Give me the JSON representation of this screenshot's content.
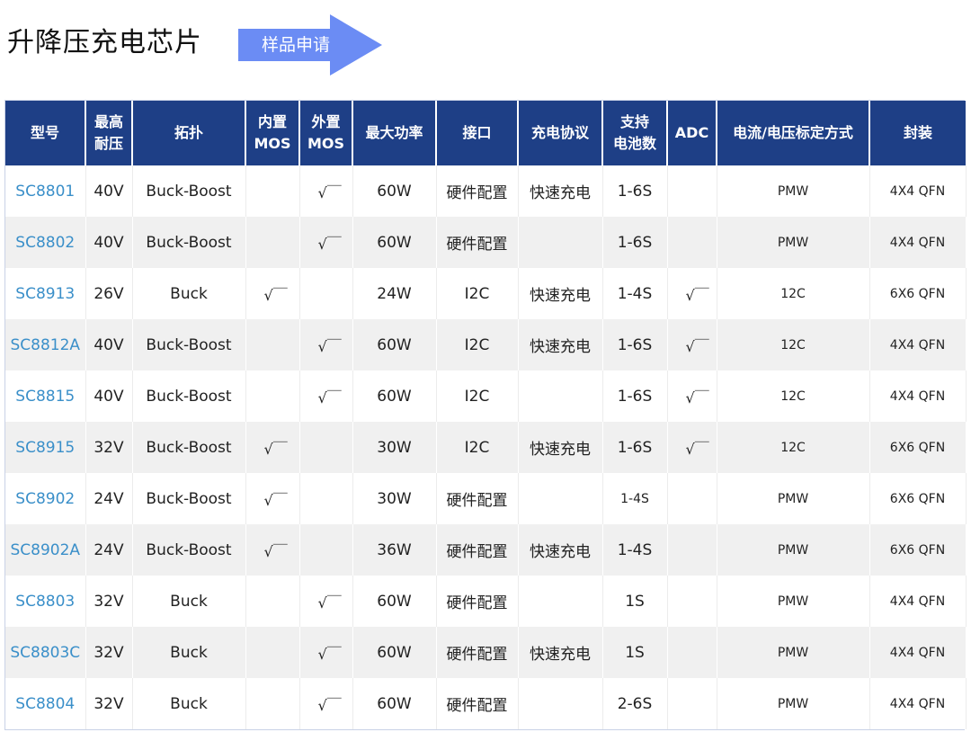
{
  "header": {
    "title": "升降压充电芯片",
    "sample_button_label": "样品申请",
    "button_color": "#6b8cf4"
  },
  "table": {
    "header_color": "#1e3f86",
    "model_color": "#3a8fc9",
    "columns": [
      {
        "key": "model",
        "line1": "型号",
        "line2": ""
      },
      {
        "key": "vmax",
        "line1": "最高",
        "line2": "耐压"
      },
      {
        "key": "topology",
        "line1": "拓扑",
        "line2": ""
      },
      {
        "key": "int_mos",
        "line1": "内置",
        "line2": "MOS"
      },
      {
        "key": "ext_mos",
        "line1": "外置",
        "line2": "MOS"
      },
      {
        "key": "pmax",
        "line1": "最大功率",
        "line2": ""
      },
      {
        "key": "interface",
        "line1": "接口",
        "line2": ""
      },
      {
        "key": "protocol",
        "line1": "充电协议",
        "line2": ""
      },
      {
        "key": "cells",
        "line1": "支持",
        "line2": "电池数"
      },
      {
        "key": "adc",
        "line1": "ADC",
        "line2": ""
      },
      {
        "key": "calib",
        "line1": "电流/电压标定方式",
        "line2": ""
      },
      {
        "key": "package",
        "line1": "封装",
        "line2": ""
      }
    ],
    "rows": [
      {
        "model": "SC8801",
        "vmax": "40V",
        "topology": "Buck-Boost",
        "int_mos": "",
        "ext_mos": "√￣",
        "pmax": "60W",
        "interface": "硬件配置",
        "protocol": "快速充电",
        "cells": "1-6S",
        "adc": "",
        "calib": "PMW",
        "package": "4X4  QFN"
      },
      {
        "model": "SC8802",
        "vmax": "40V",
        "topology": "Buck-Boost",
        "int_mos": "",
        "ext_mos": "√￣",
        "pmax": "60W",
        "interface": "硬件配置",
        "protocol": "",
        "cells": "1-6S",
        "adc": "",
        "calib": "PMW",
        "package": "4X4 QFN"
      },
      {
        "model": "SC8913",
        "vmax": "26V",
        "topology": "Buck",
        "int_mos": "√￣",
        "ext_mos": "",
        "pmax": "24W",
        "interface": "I2C",
        "protocol": "快速充电",
        "cells": "1-4S",
        "adc": "√￣",
        "calib": "12C",
        "package": "6X6 QFN"
      },
      {
        "model": "SC8812A",
        "vmax": "40V",
        "topology": "Buck-Boost",
        "int_mos": "",
        "ext_mos": "√￣",
        "pmax": "60W",
        "interface": "I2C",
        "protocol": "快速充电",
        "cells": "1-6S",
        "adc": "√￣",
        "calib": "12C",
        "package": "4X4 QFN"
      },
      {
        "model": "SC8815",
        "vmax": "40V",
        "topology": "Buck-Boost",
        "int_mos": "",
        "ext_mos": "√￣",
        "pmax": "60W",
        "interface": "I2C",
        "protocol": "",
        "cells": "1-6S",
        "adc": "√￣",
        "calib": "12C",
        "package": "4X4 QFN"
      },
      {
        "model": "SC8915",
        "vmax": "32V",
        "topology": "Buck-Boost",
        "int_mos": "√￣",
        "ext_mos": "",
        "pmax": "30W",
        "interface": "I2C",
        "protocol": "快速充电",
        "cells": "1-6S",
        "adc": "√￣",
        "calib": "12C",
        "package": "6X6 QFN"
      },
      {
        "model": "SC8902",
        "vmax": "24V",
        "topology": "Buck-Boost",
        "int_mos": "√￣",
        "ext_mos": "",
        "pmax": "30W",
        "interface": "硬件配置",
        "protocol": "",
        "cells": "1-4S",
        "adc": "",
        "calib": "PMW",
        "package": "6X6 QFN"
      },
      {
        "model": "SC8902A",
        "vmax": "24V",
        "topology": "Buck-Boost",
        "int_mos": "√￣",
        "ext_mos": "",
        "pmax": "36W",
        "interface": "硬件配置",
        "protocol": "快速充电",
        "cells": "1-4S",
        "adc": "",
        "calib": "PMW",
        "package": "6X6 QFN"
      },
      {
        "model": "SC8803",
        "vmax": "32V",
        "topology": "Buck",
        "int_mos": "",
        "ext_mos": "√￣",
        "pmax": "60W",
        "interface": "硬件配置",
        "protocol": "",
        "cells": "1S",
        "adc": "",
        "calib": "PMW",
        "package": "4X4 QFN"
      },
      {
        "model": "SC8803C",
        "vmax": "32V",
        "topology": "Buck",
        "int_mos": "",
        "ext_mos": "√￣",
        "pmax": "60W",
        "interface": "硬件配置",
        "protocol": "快速充电",
        "cells": "1S",
        "adc": "",
        "calib": "PMW",
        "package": "4X4 QFN"
      },
      {
        "model": "SC8804",
        "vmax": "32V",
        "topology": "Buck",
        "int_mos": "",
        "ext_mos": "√￣",
        "pmax": "60W",
        "interface": "硬件配置",
        "protocol": "",
        "cells": "2-6S",
        "adc": "",
        "calib": "PMW",
        "package": "4X4 QFN"
      }
    ]
  }
}
